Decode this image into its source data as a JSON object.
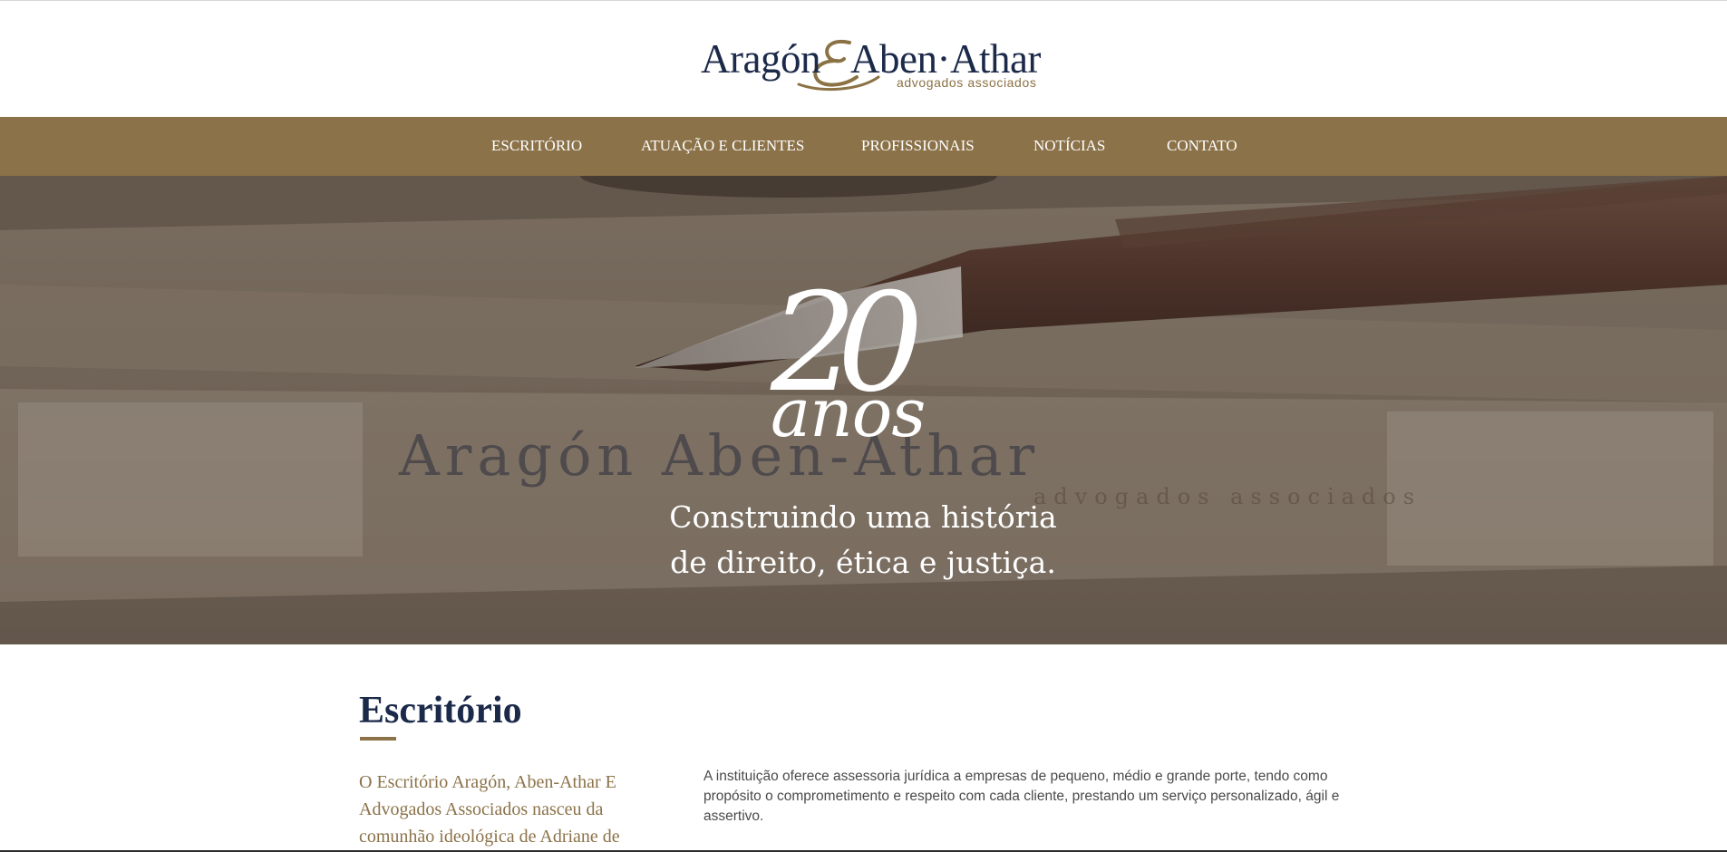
{
  "brand": {
    "name_part1": "Aragón",
    "name_part2": "Aben·Athar",
    "subtitle": "advogados associados"
  },
  "nav": {
    "items": [
      {
        "label": "ESCRITÓRIO"
      },
      {
        "label": "ATUAÇÃO E CLIENTES"
      },
      {
        "label": "PROFISSIONAIS"
      },
      {
        "label": "NOTÍCIAS"
      },
      {
        "label": "CONTATO"
      }
    ]
  },
  "hero": {
    "number": "20",
    "word": "anos",
    "tagline_line1": "Construindo uma história",
    "tagline_line2": "de direito, ética e justiça.",
    "background_card_text": "Aragón Aben-Athar",
    "background_card_subtext": "advogados associados"
  },
  "section": {
    "title": "Escritório",
    "intro": "O Escritório Aragón, Aben-Athar E Advogados Associados nasceu da comunhão ideológica de Adriane de",
    "body": "A instituição oferece assessoria jurídica a empresas de pequeno, médio e grande porte, tendo como propósito o comprometimento e respeito com cada cliente, prestando um serviço personalizado, ágil e assertivo."
  },
  "colors": {
    "navy": "#1c2a4a",
    "gold": "#8b7249",
    "text": "#4a4a4a"
  }
}
